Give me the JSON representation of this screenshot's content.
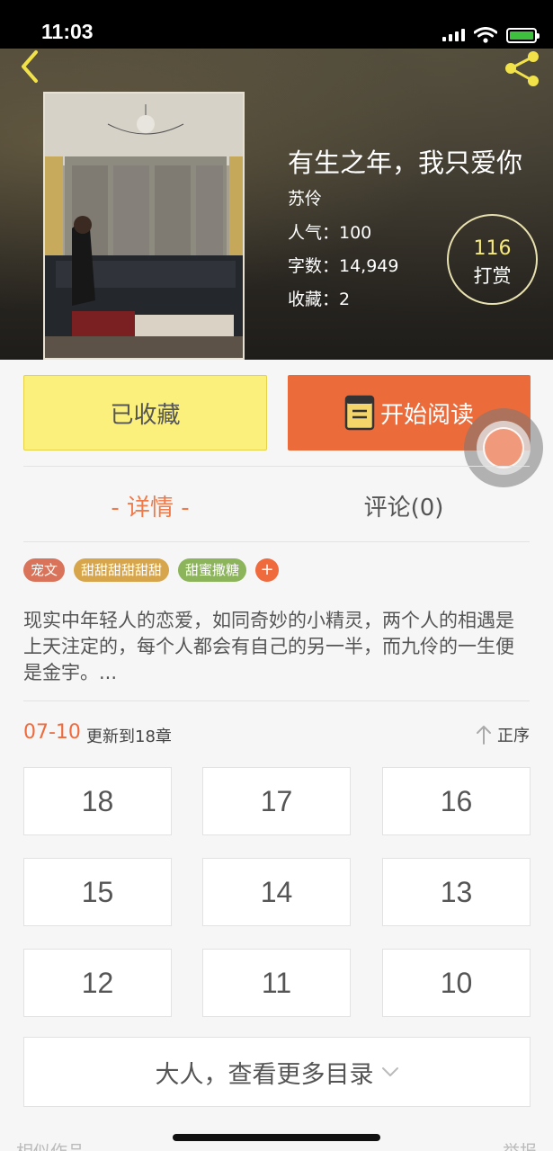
{
  "status": {
    "time": "11:03"
  },
  "book": {
    "title": "有生之年，我只爱你",
    "author": "苏伶",
    "popularity": "人气：100",
    "words": "字数：14,949",
    "favorites": "收藏：2"
  },
  "tip": {
    "count": "116",
    "label": "打赏"
  },
  "actions": {
    "favorited_label": "已收藏",
    "read_label": "开始阅读"
  },
  "tabs": {
    "detail": "- 详情 -",
    "comments": "评论(0)"
  },
  "tags": [
    {
      "label": "宠文",
      "color": "#d9745a"
    },
    {
      "label": "甜甜甜甜甜甜",
      "color": "#d6a54c"
    },
    {
      "label": "甜蜜撒糖",
      "color": "#8cb45a"
    }
  ],
  "tag_add": "+",
  "synopsis": "现实中年轻人的恋爱，如同奇妙的小精灵，两个人的相遇是上天注定的，每个人都会有自己的另一半，而九伶的一生便是金宇。...",
  "update": {
    "date": "07-10",
    "text": "更新到18章",
    "order": "正序"
  },
  "chapters": [
    "18",
    "17",
    "16",
    "15",
    "14",
    "13",
    "12",
    "11",
    "10"
  ],
  "more": {
    "label": "大人，查看更多目录"
  },
  "footer": {
    "left": "相似作品",
    "right": "举报"
  },
  "colors": {
    "accent": "#eb6b3b",
    "favorite": "#fbf07c",
    "tip_count": "#f5e97a"
  },
  "icons": [
    "back-icon",
    "share-icon",
    "book-icon",
    "arrow-up-icon",
    "chevron-down-icon",
    "signal-icon",
    "wifi-icon",
    "battery-icon"
  ]
}
